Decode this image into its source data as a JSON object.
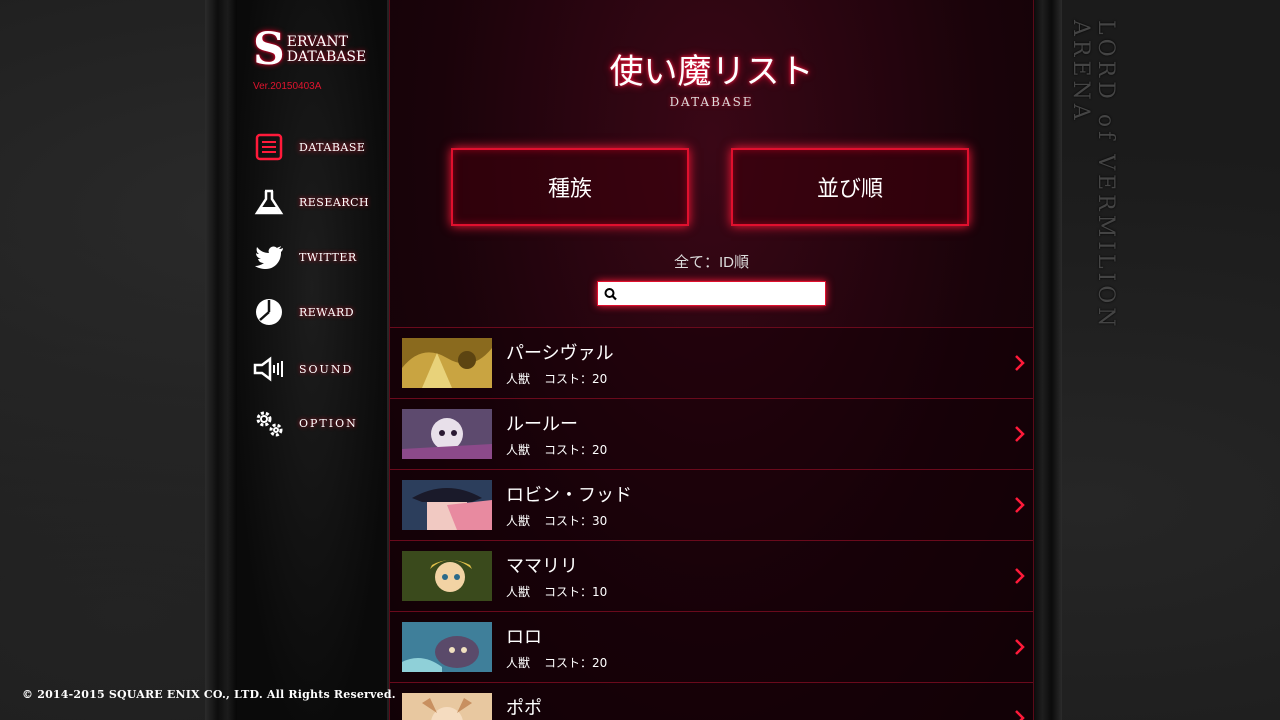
{
  "logo": {
    "s": "S",
    "line1": "ERVANT",
    "line2": "DATABASE"
  },
  "version": "Ver.20150403A",
  "nav": [
    {
      "label": "DATABASE",
      "icon": "document-icon"
    },
    {
      "label": "RESEARCH",
      "icon": "flask-icon"
    },
    {
      "label": "TWITTER",
      "icon": "twitter-bird-icon"
    },
    {
      "label": "REWARD",
      "icon": "pie-chart-icon"
    },
    {
      "label": "SOUND",
      "icon": "speaker-icon"
    },
    {
      "label": "OPTION",
      "icon": "gears-icon"
    }
  ],
  "page": {
    "title": "使い魔リスト",
    "subtitle": "DATABASE"
  },
  "filters": {
    "race": "種族",
    "order": "並び順",
    "status": "全て：ID順"
  },
  "search": {
    "value": "",
    "placeholder": ""
  },
  "servants": [
    {
      "name": "パーシヴァル",
      "race": "人獣",
      "cost_label": "コスト：20"
    },
    {
      "name": "ルールー",
      "race": "人獣",
      "cost_label": "コスト：20"
    },
    {
      "name": "ロビン・フッド",
      "race": "人獣",
      "cost_label": "コスト：30"
    },
    {
      "name": "ママリリ",
      "race": "人獣",
      "cost_label": "コスト：10"
    },
    {
      "name": "ロロ",
      "race": "人獣",
      "cost_label": "コスト：20"
    },
    {
      "name": "ポポ",
      "race": "",
      "cost_label": ""
    }
  ],
  "side_title": "LORD of VERMILION ARENA",
  "copyright": "© 2014-2015 SQUARE ENIX CO., LTD. All Rights Reserved.",
  "colors": {
    "accent": "#e0102e",
    "panel": "#1a030a"
  }
}
